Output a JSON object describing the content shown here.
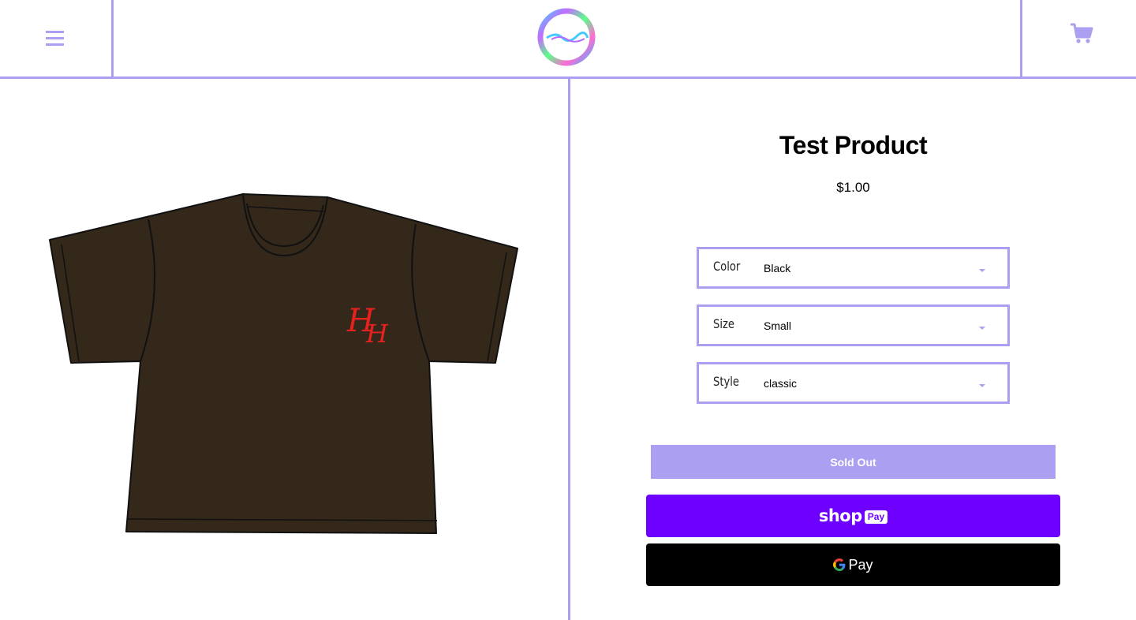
{
  "header": {
    "menu_icon": "hamburger-menu-icon",
    "logo_icon": "store-logo-icon",
    "cart_icon": "shopping-cart-icon"
  },
  "colors": {
    "accent": "#ab9ff2",
    "shop_pay": "#6e00ff",
    "gpay": "#000000",
    "shirt": "#33281a",
    "monogram": "#e8211f"
  },
  "product": {
    "title": "Test Product",
    "price": "$1.00",
    "image_icon": "tshirt-product-image"
  },
  "options": [
    {
      "label": "Color",
      "value": "Black"
    },
    {
      "label": "Size",
      "value": "Small"
    },
    {
      "label": "Style",
      "value": "classic"
    }
  ],
  "buttons": {
    "sold_out": "Sold Out",
    "shop_pay_word": "shop",
    "shop_pay_badge": "Pay",
    "gpay_text": "Pay"
  }
}
